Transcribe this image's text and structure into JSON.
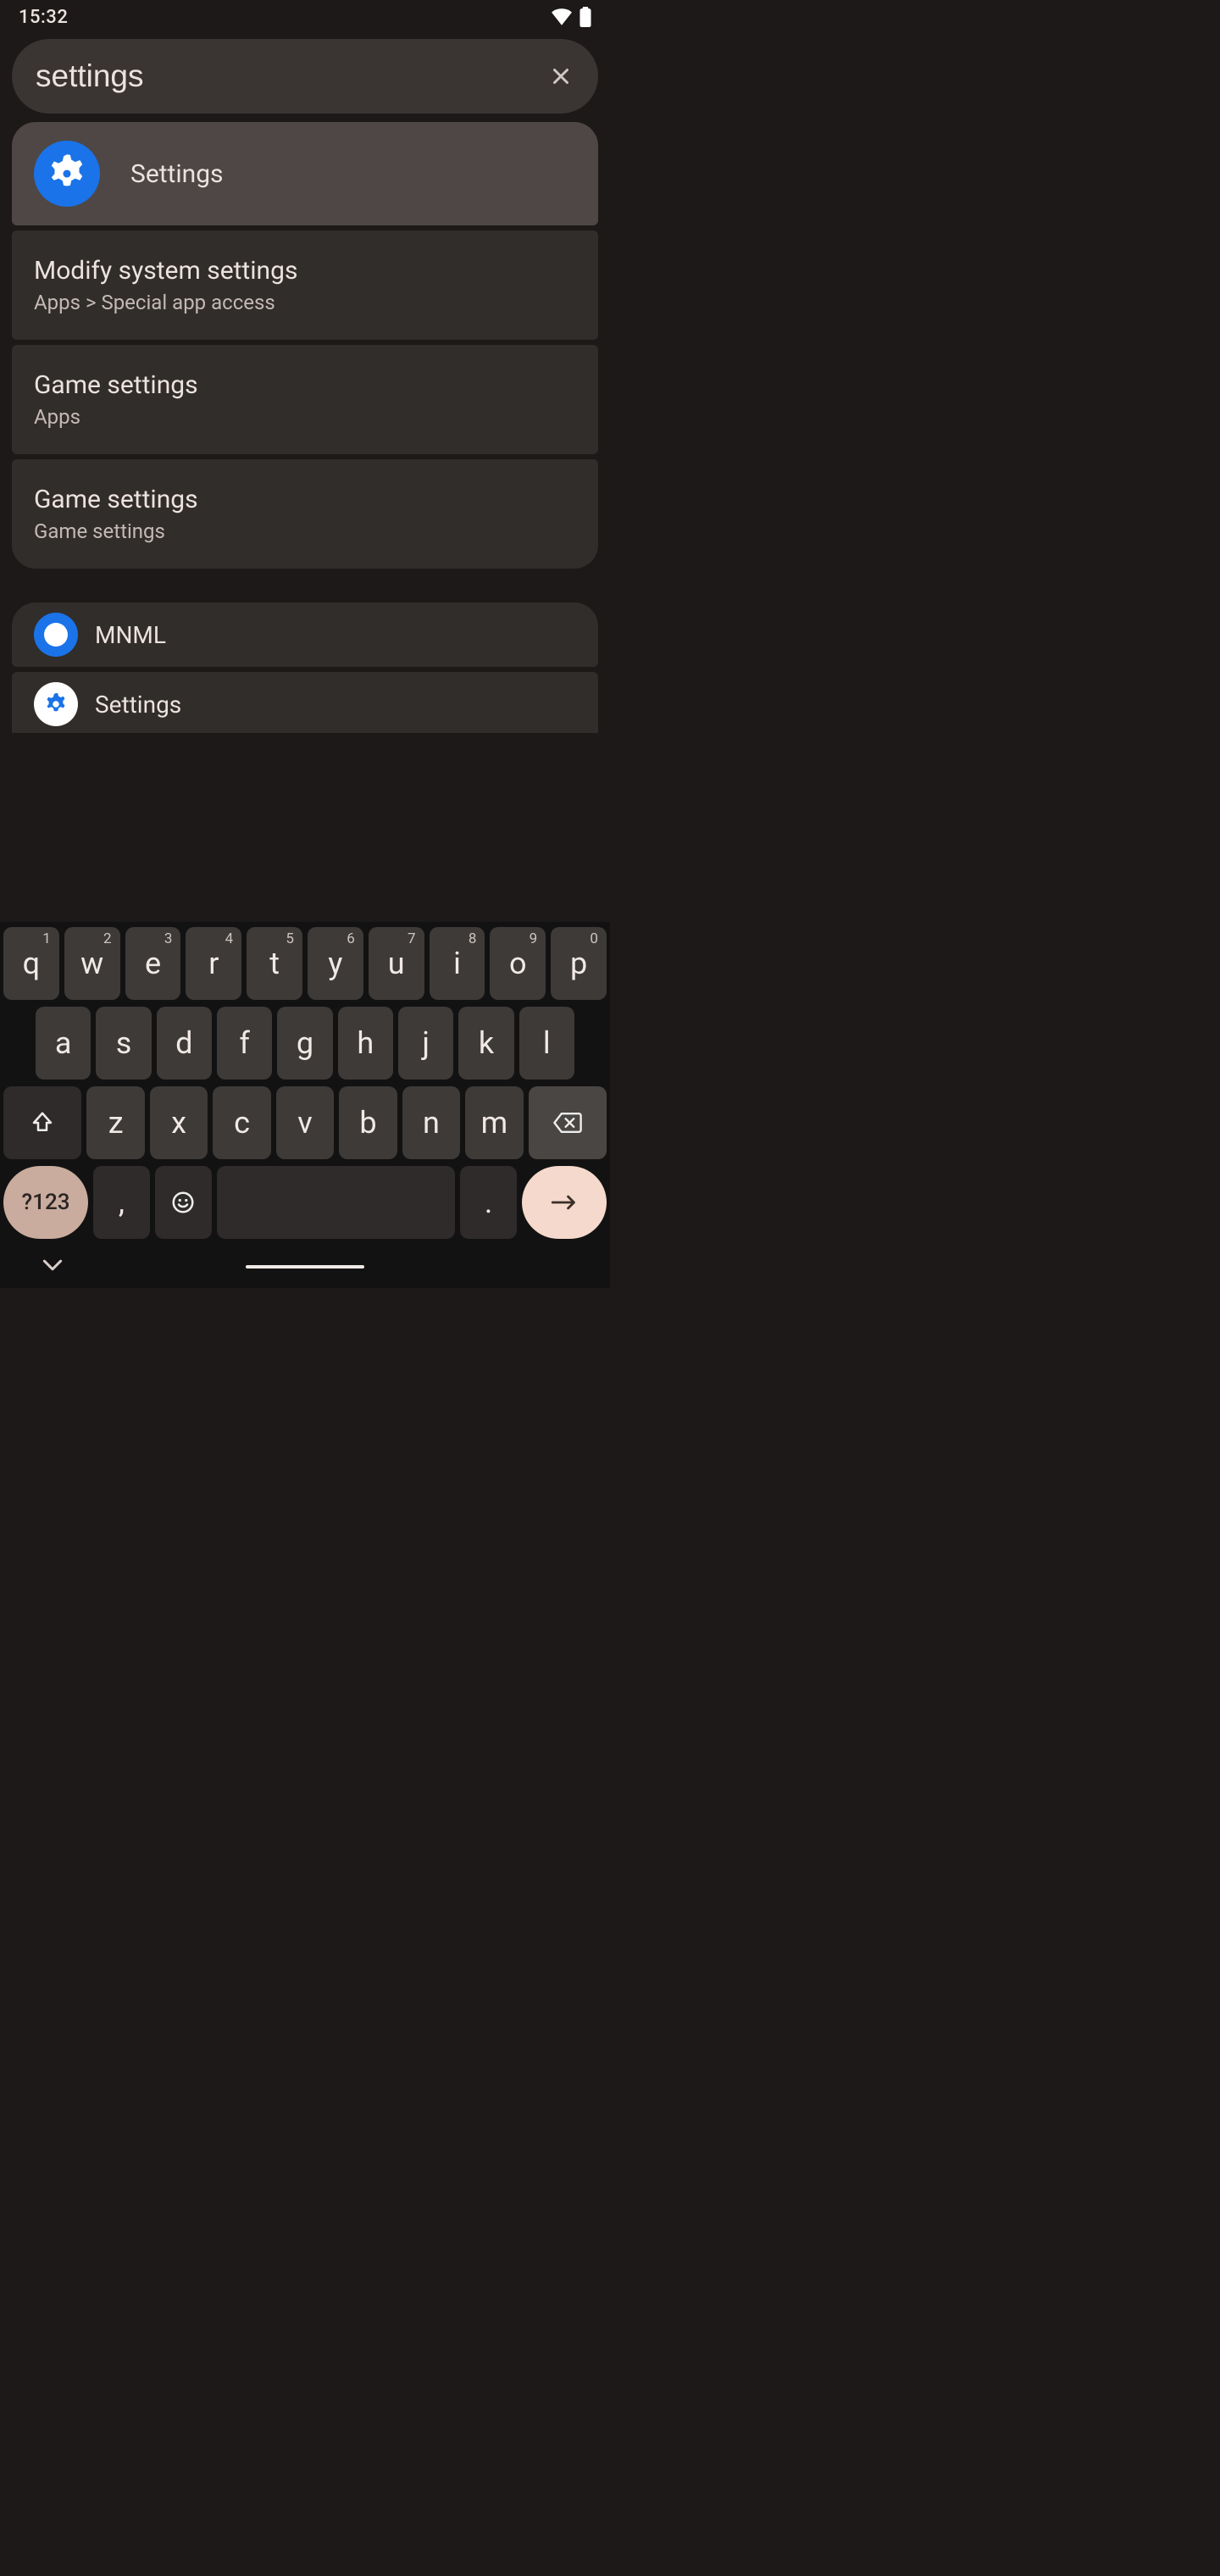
{
  "status": {
    "time": "15:32"
  },
  "search": {
    "value": "settings"
  },
  "results": {
    "top_app": {
      "title": "Settings"
    },
    "r1": {
      "title": "Modify system settings",
      "path": "Apps > Special app access"
    },
    "r2": {
      "title": "Game settings",
      "path": "Apps"
    },
    "r3": {
      "title": "Game settings",
      "path": "Game settings"
    },
    "list1": {
      "title": "MNML"
    },
    "list2": {
      "title": "Settings"
    }
  },
  "keyboard": {
    "row1": [
      {
        "k": "q",
        "s": "1"
      },
      {
        "k": "w",
        "s": "2"
      },
      {
        "k": "e",
        "s": "3"
      },
      {
        "k": "r",
        "s": "4"
      },
      {
        "k": "t",
        "s": "5"
      },
      {
        "k": "y",
        "s": "6"
      },
      {
        "k": "u",
        "s": "7"
      },
      {
        "k": "i",
        "s": "8"
      },
      {
        "k": "o",
        "s": "9"
      },
      {
        "k": "p",
        "s": "0"
      }
    ],
    "row2": [
      "a",
      "s",
      "d",
      "f",
      "g",
      "h",
      "j",
      "k",
      "l"
    ],
    "row3": [
      "z",
      "x",
      "c",
      "v",
      "b",
      "n",
      "m"
    ],
    "numsym": "?123",
    "comma": ",",
    "period": "."
  }
}
